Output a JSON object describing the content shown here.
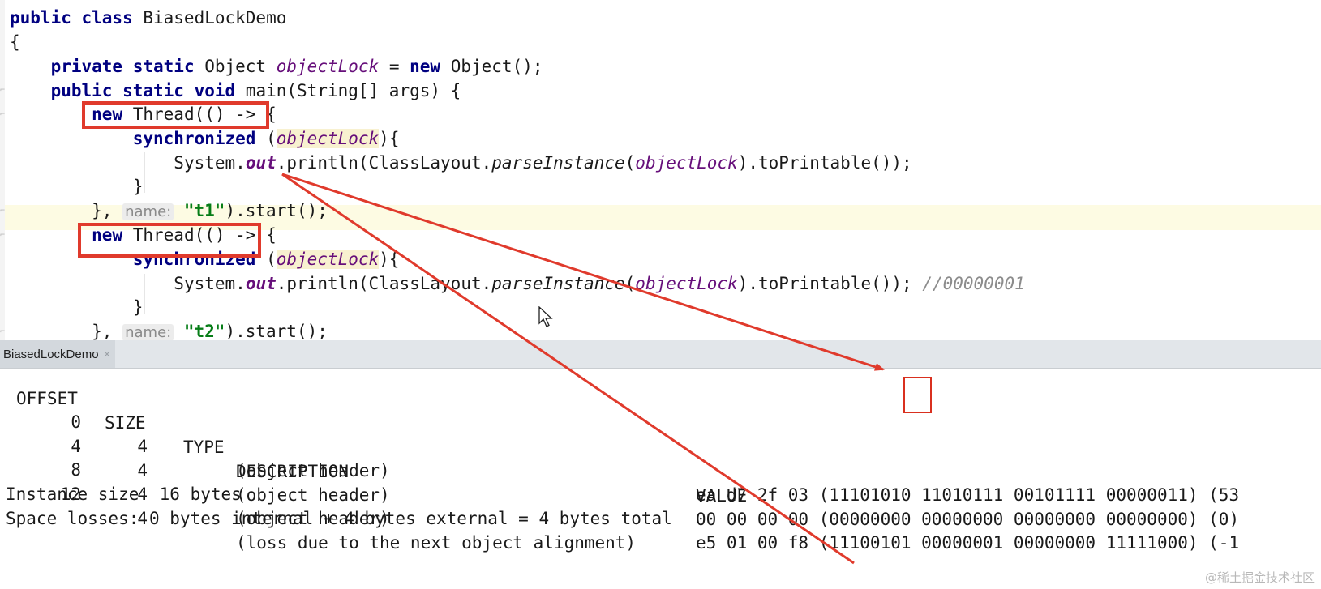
{
  "code": {
    "l1_kw": "public class",
    "l1_name": " BiasedLockDemo",
    "l2": "{",
    "l3_kw": "private static",
    "l3_type": " Object ",
    "l3_field": "objectLock",
    "l3_eq": " = ",
    "l3_new": "new",
    "l3_rest": " Object();",
    "l4_kw": "public static void",
    "l4_rest": " main(String[] args) {",
    "l5_new": "new",
    "l5_rest": " Thread(() -> {",
    "l6_sync": "synchronized",
    "l6_open": " (",
    "l6_field": "objectLock",
    "l6_close": "){",
    "l7_sys": "System.",
    "l7_out": "out",
    "l7_println": ".println(ClassLayout.",
    "l7_parse": "parseInstance",
    "l7_paren": "(",
    "l7_field": "objectLock",
    "l7_rest": ").toPrintable());",
    "l8": "}",
    "l9_close": "}, ",
    "l9_hint": "name:",
    "l9_str": "\"t1\"",
    "l9_rest": ").start();",
    "l10_new": "new",
    "l10_rest": " Thread(() -> {",
    "l11_sync": "synchronized",
    "l11_open": " (",
    "l11_field": "objectLock",
    "l11_close": "){",
    "l12_sys": "System.",
    "l12_out": "out",
    "l12_println": ".println(ClassLayout.",
    "l12_parse": "parseInstance",
    "l12_paren": "(",
    "l12_field": "objectLock",
    "l12_rest": ").toPrintable()); ",
    "l12_comment": "//00000001",
    "l13": "}",
    "l14_close": "}, ",
    "l14_hint": "name:",
    "l14_str": "\"t2\"",
    "l14_rest": ").start();"
  },
  "console_tab": {
    "label": "BiasedLockDemo",
    "close": "×"
  },
  "console": {
    "headers": {
      "offset": "OFFSET",
      "size": "SIZE",
      "type": "TYPE",
      "description": "DESCRIPTION",
      "value": "VALUE"
    },
    "rows": [
      {
        "offset": "0",
        "size": "4",
        "description": "(object header)",
        "value": "ea d7 2f 03 (11101010 11010111 00101111 00000011) (53"
      },
      {
        "offset": "4",
        "size": "4",
        "description": "(object header)",
        "value": "00 00 00 00 (00000000 00000000 00000000 00000000) (0)"
      },
      {
        "offset": "8",
        "size": "4",
        "description": "(object header)",
        "value": "e5 01 00 f8 (11100101 00000001 00000000 11111000) (-1"
      },
      {
        "offset": "12",
        "size": "4",
        "description": "(loss due to the next object alignment)",
        "value": ""
      }
    ],
    "instance_size": "Instance size: 16 bytes",
    "space_losses": "Space losses: 0 bytes internal + 4 bytes external = 4 bytes total"
  },
  "watermark": "@稀土掘金技术社区",
  "colors": {
    "keyword": "#000080",
    "field": "#660e7a",
    "string": "#067d17",
    "annotation_red": "#e03a2c"
  }
}
